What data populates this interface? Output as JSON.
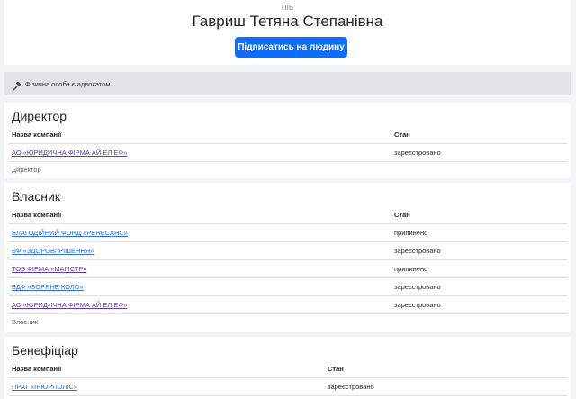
{
  "person": {
    "label": "ПІБ",
    "name": "Гавриш Тетяна Степанівна",
    "subscribe_label": "Підписатись на людину"
  },
  "lawyer_note": {
    "icon": "gavel-icon",
    "text": "Фізична особа є адвокатом"
  },
  "colors": {
    "primary": "#0d6efd",
    "link": "#2f6fdb",
    "visited_link": "#5b3fa8"
  },
  "sections": [
    {
      "title": "Директор",
      "col_company": "Назва компанії",
      "col_state": "Стан",
      "rows": [
        {
          "company": "АО «ЮРИДИЧНА ФІРМА АЙ ЕЛ ЕФ»",
          "state": "зареєстровано"
        }
      ],
      "role": "Директор"
    },
    {
      "title": "Власник",
      "col_company": "Назва компанії",
      "col_state": "Стан",
      "rows": [
        {
          "company": "БЛАГОДІЙНИЙ ФОНД «РЕНЕСАНС»",
          "state": "припинено"
        },
        {
          "company": "БФ «ЗДОРОВІ РІШЕННЯ»",
          "state": "зареєстровано"
        },
        {
          "company": "ТОВ ФІРМА «МАГІСТР»",
          "state": "припинено"
        },
        {
          "company": "БДФ «ЗОРЯНЕ КОЛО»",
          "state": "зареєстровано"
        },
        {
          "company": "АО «ЮРИДИЧНА ФІРМА АЙ ЕЛ ЕФ»",
          "state": "зареєстровано"
        }
      ],
      "role": "Власник"
    },
    {
      "title": "Бенефіціар",
      "col_company": "Назва компанії",
      "col_state": "Стан",
      "rows": [
        {
          "company": "ПРАТ «ІНЮРПОЛІС»",
          "state": "зареєстровано"
        }
      ]
    }
  ]
}
